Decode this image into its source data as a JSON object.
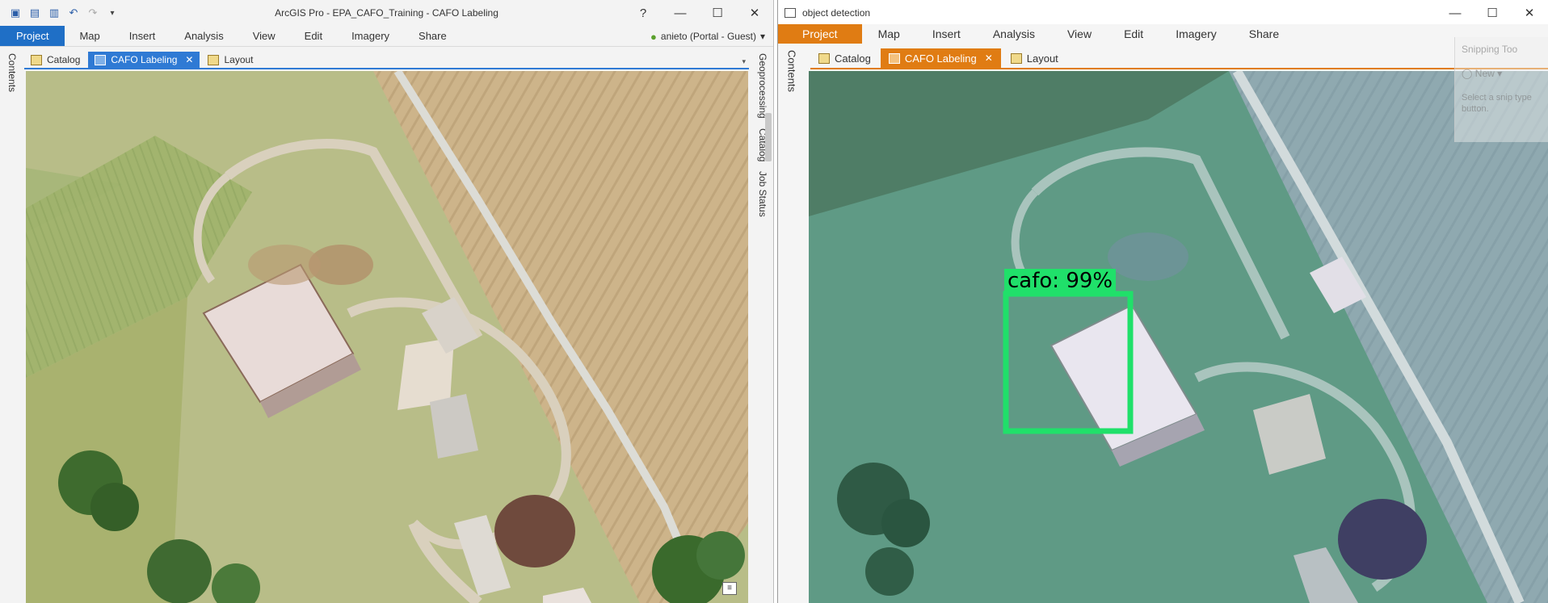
{
  "left_window": {
    "title": "ArcGIS Pro - EPA_CAFO_Training - CAFO Labeling",
    "help_label": "?",
    "ribbon_tabs": [
      "Project",
      "Map",
      "Insert",
      "Analysis",
      "View",
      "Edit",
      "Imagery",
      "Share"
    ],
    "account": "anieto (Portal - Guest)",
    "view_tabs": [
      {
        "label": "Catalog",
        "active": false
      },
      {
        "label": "CAFO Labeling",
        "active": true,
        "closable": true
      },
      {
        "label": "Layout",
        "active": false
      }
    ],
    "side_left": [
      "Contents"
    ],
    "side_right": [
      "Geoprocessing",
      "Catalog",
      "Job Status"
    ],
    "accent": "#1f6fc6"
  },
  "right_window": {
    "title": "object detection",
    "ribbon_tabs": [
      "Project",
      "Map",
      "Insert",
      "Analysis",
      "View",
      "Edit",
      "Imagery",
      "Share"
    ],
    "view_tabs": [
      {
        "label": "Catalog",
        "active": false
      },
      {
        "label": "CAFO Labeling",
        "active": true,
        "closable": true
      },
      {
        "label": "Layout",
        "active": false
      }
    ],
    "side_left": [
      "Contents"
    ],
    "detection_label": "cafo: 99%",
    "detection_color": "#20e06a",
    "accent": "#e07c13"
  },
  "snipping_tool": {
    "title": "Snipping Too",
    "new_label": "New",
    "hint": "Select a snip type button."
  },
  "icons": {
    "close": "✕",
    "minimize": "—",
    "maximize": "☐",
    "tab_close": "✕",
    "chevron": "▾"
  }
}
